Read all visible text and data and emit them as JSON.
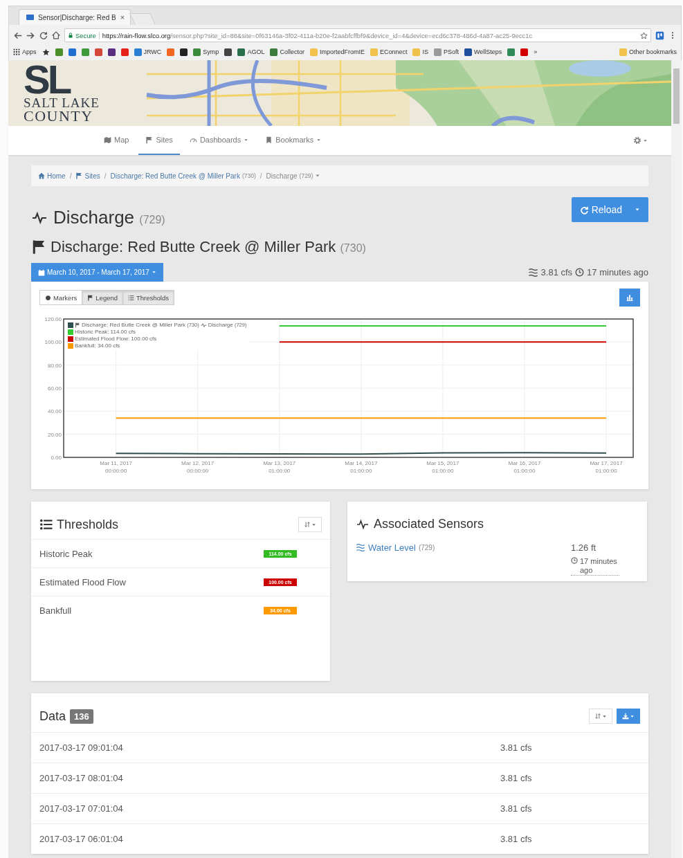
{
  "browser": {
    "tab": {
      "title": "Sensor|Discharge: Red B",
      "close": "×"
    },
    "address": {
      "secure": "Secure",
      "host": "https://rain-flow.slco.org",
      "path": "/sensor.php?site_id=88&site=0f63146a-3f02-411a-b20e-f2aabfcffbf9&device_id=4&device=ecd6c378-486d-4a87-ac25-9ecc1c"
    },
    "bookmarks": [
      {
        "kind": "apps",
        "label": "Apps"
      },
      {
        "kind": "star"
      },
      {
        "kind": "icon",
        "color": "#4a8f2a"
      },
      {
        "kind": "icon",
        "color": "#1e6fd0"
      },
      {
        "kind": "icon",
        "color": "#3b9a3b"
      },
      {
        "kind": "icon",
        "color": "#d44638"
      },
      {
        "kind": "icon",
        "color": "#5a2d82"
      },
      {
        "kind": "icon",
        "color": "#e62117"
      },
      {
        "kind": "link",
        "label": "JRWC",
        "color": "#2a7fd4"
      },
      {
        "kind": "icon",
        "color": "#f26522"
      },
      {
        "kind": "icon",
        "color": "#222222"
      },
      {
        "kind": "link",
        "label": "Symp",
        "color": "#3c8b3c"
      },
      {
        "kind": "icon",
        "color": "#444444"
      },
      {
        "kind": "link",
        "label": "AGOL",
        "color": "#2b6e4e"
      },
      {
        "kind": "link",
        "label": "Collector",
        "color": "#3a7a3a"
      },
      {
        "kind": "link",
        "label": "ImportedFromIE",
        "color": "#f0c24b"
      },
      {
        "kind": "link",
        "label": "EConnect",
        "color": "#f0c24b"
      },
      {
        "kind": "link",
        "label": "IS",
        "color": "#f0c24b"
      },
      {
        "kind": "link",
        "label": "PSoft",
        "color": "#9a9a9a"
      },
      {
        "kind": "link",
        "label": "WellSteps",
        "color": "#1f4e9a"
      },
      {
        "kind": "icon",
        "color": "#2e8b57"
      },
      {
        "kind": "icon",
        "color": "#d40000"
      },
      {
        "kind": "more",
        "label": "»"
      }
    ],
    "other_bookmarks": "Other bookmarks"
  },
  "header": {
    "logo": {
      "mark": "SL",
      "line1": "SALT LAKE",
      "line2": "COUNTY"
    }
  },
  "nav": {
    "items": [
      {
        "label": "Map",
        "kind": "map",
        "selected": false,
        "dropdown": false
      },
      {
        "label": "Sites",
        "kind": "flag",
        "selected": true,
        "dropdown": false
      },
      {
        "label": "Dashboards",
        "kind": "dashboard",
        "selected": false,
        "dropdown": true
      },
      {
        "label": "Bookmarks",
        "kind": "bookmark",
        "selected": false,
        "dropdown": true
      }
    ]
  },
  "breadcrumb": [
    {
      "kind": "home",
      "label": "Home",
      "separator": "/"
    },
    {
      "kind": "flag",
      "label": "Sites",
      "separator": "/"
    },
    {
      "kind": "link",
      "label": "Discharge: Red Butte Creek @ Miller Park",
      "count": "(730)",
      "separator": "/"
    },
    {
      "kind": "current",
      "label": "Discharge",
      "count": "(729)"
    }
  ],
  "sensor": {
    "title": "Discharge",
    "id": "(729)",
    "site": "Discharge: Red Butte Creek @ Miller Park",
    "site_id": "(730)",
    "reload": "Reload",
    "date_range": "March 10, 2017 - March 17, 2017",
    "latest_value": "3.81 cfs",
    "latest_age": "17 minutes ago"
  },
  "chart": {
    "toggles": [
      {
        "kind": "markers",
        "label": "Markers",
        "selected": false
      },
      {
        "kind": "legend",
        "label": "Legend",
        "selected": true
      },
      {
        "kind": "thresholds",
        "label": "Thresholds",
        "selected": true
      }
    ],
    "legend_site": {
      "label": "Discharge: Red Butte Creek @ Miller Park",
      "site_id": "(730)",
      "sensor_id": "(729)"
    },
    "chart_data": {
      "type": "line",
      "grid": true,
      "categories": [
        "Mar 11, 2017 00:00:00",
        "Mar 12, 2017 00:00:00",
        "Mar 13, 2017 01:00:00",
        "Mar 14, 2017 01:00:00",
        "Mar 15, 2017 01:00:00",
        "Mar 16, 2017 01:00:00",
        "Mar 17, 2017 01:00:00"
      ],
      "ylim": [
        0,
        120
      ],
      "yticks": [
        {
          "value": 0,
          "label": "0.00"
        },
        {
          "value": 20,
          "label": "20.00"
        },
        {
          "value": 40,
          "label": "40.00"
        },
        {
          "value": 60,
          "label": "60.00"
        },
        {
          "value": 80,
          "label": "80.00"
        },
        {
          "value": 100,
          "label": "100.00"
        },
        {
          "value": 120,
          "label": "120.00"
        }
      ],
      "series": [
        {
          "name": "Discharge",
          "color": "#2f4f4f",
          "values": [
            3.4,
            3.2,
            3.0,
            2.8,
            3.9,
            4.0,
            3.8
          ]
        },
        {
          "name": "Historic Peak: 114.00 cfs",
          "color": "#33cc33",
          "values": [
            null,
            null,
            114,
            114,
            114,
            114,
            114
          ]
        },
        {
          "name": "Estimated Flood Flow: 100.00 cfs",
          "color": "#cc0000",
          "values": [
            null,
            null,
            100,
            100,
            100,
            100,
            100
          ]
        },
        {
          "name": "Bankfull: 34.00 cfs",
          "color": "#ff9900",
          "values": [
            34,
            34,
            34,
            34,
            34,
            34,
            34
          ]
        }
      ]
    }
  },
  "thresholds": {
    "title": "Thresholds",
    "rows": [
      {
        "name": "Historic Peak",
        "value": "114.00 cfs",
        "color": "#33bb22"
      },
      {
        "name": "Estimated Flood Flow",
        "value": "100.00 cfs",
        "color": "#cc0000"
      },
      {
        "name": "Bankfull",
        "value": "34.00 cfs",
        "color": "#ff9900"
      }
    ]
  },
  "associated": {
    "title": "Associated Sensors",
    "sensors": [
      {
        "name": "Water Level",
        "id": "(729)",
        "value": "1.26 ft",
        "age": "17 minutes ago"
      }
    ]
  },
  "data": {
    "title": "Data",
    "count": "136",
    "rows": [
      {
        "time": "2017-03-17 09:01:04",
        "value": "3.81 cfs"
      },
      {
        "time": "2017-03-17 08:01:04",
        "value": "3.81 cfs"
      },
      {
        "time": "2017-03-17 07:01:04",
        "value": "3.81 cfs"
      },
      {
        "time": "2017-03-17 06:01:04",
        "value": "3.81 cfs"
      }
    ]
  }
}
